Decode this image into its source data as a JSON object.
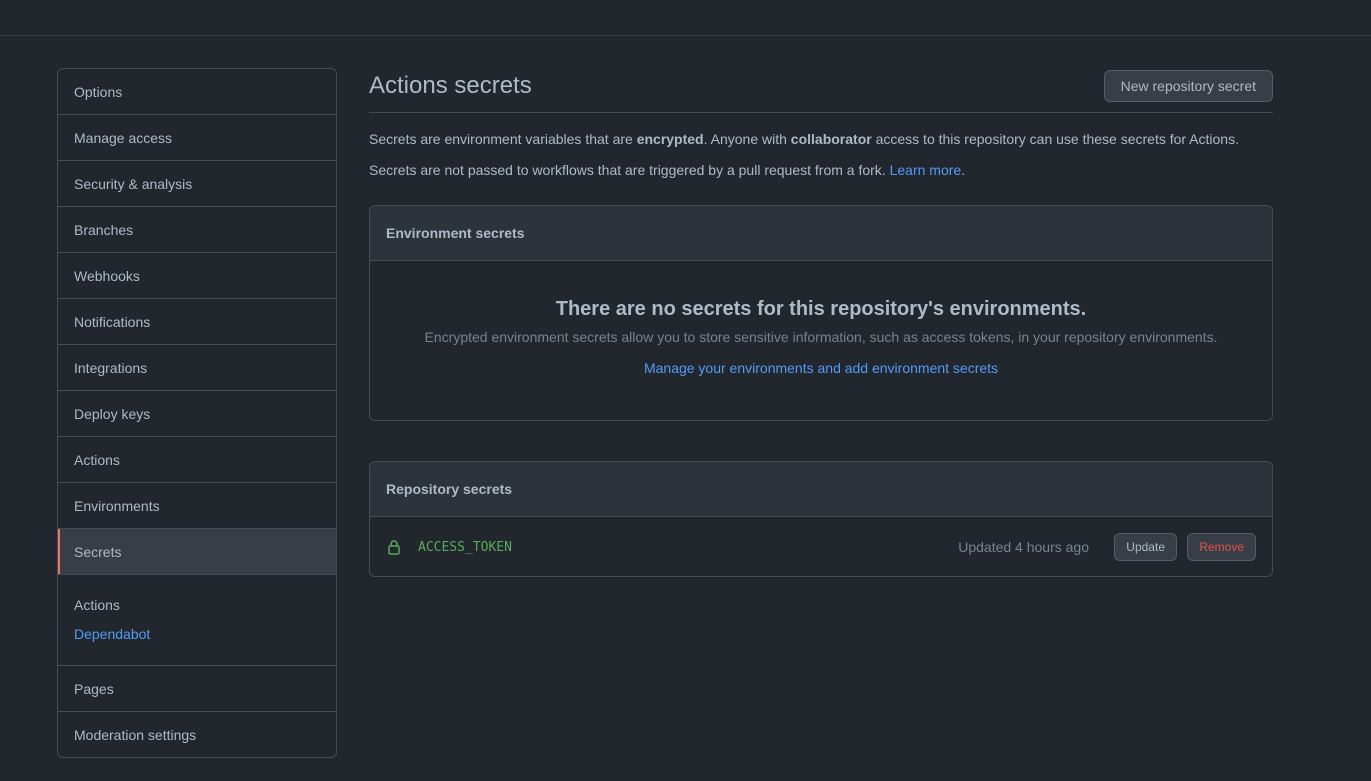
{
  "sidebar": {
    "items_top": [
      {
        "label": "Options"
      },
      {
        "label": "Manage access"
      },
      {
        "label": "Security & analysis"
      },
      {
        "label": "Branches"
      },
      {
        "label": "Webhooks"
      },
      {
        "label": "Notifications"
      },
      {
        "label": "Integrations"
      },
      {
        "label": "Deploy keys"
      },
      {
        "label": "Actions"
      },
      {
        "label": "Environments"
      },
      {
        "label": "Secrets",
        "selected": true
      }
    ],
    "secrets_sub": {
      "actions_label": "Actions",
      "dependabot_label": "Dependabot"
    },
    "items_bottom": [
      {
        "label": "Pages"
      },
      {
        "label": "Moderation settings"
      }
    ]
  },
  "main": {
    "title": "Actions secrets",
    "new_secret_button": "New repository secret",
    "desc1": {
      "part1": "Secrets are environment variables that are ",
      "bold1": "encrypted",
      "part2": ". Anyone with ",
      "bold2": "collaborator",
      "part3": " access to this repository can use these secrets for Actions."
    },
    "desc2": {
      "text": "Secrets are not passed to workflows that are triggered by a pull request from a fork. ",
      "link": "Learn more",
      "end": "."
    },
    "environment_secrets": {
      "header": "Environment secrets",
      "blank_title": "There are no secrets for this repository's environments.",
      "blank_desc": "Encrypted environment secrets allow you to store sensitive information, such as access tokens, in your repository environments.",
      "blank_link": "Manage your environments and add environment secrets"
    },
    "repository_secrets": {
      "header": "Repository secrets",
      "secrets": [
        {
          "icon": "lock-icon",
          "name": "ACCESS_TOKEN",
          "updated": "Updated 4 hours ago",
          "update_label": "Update",
          "remove_label": "Remove"
        }
      ]
    }
  },
  "colors": {
    "background": "#22272e",
    "accent_link": "#539bf5",
    "selected_marker": "#ec775c",
    "secret_name": "#57ab5a",
    "danger": "#e5534b"
  }
}
